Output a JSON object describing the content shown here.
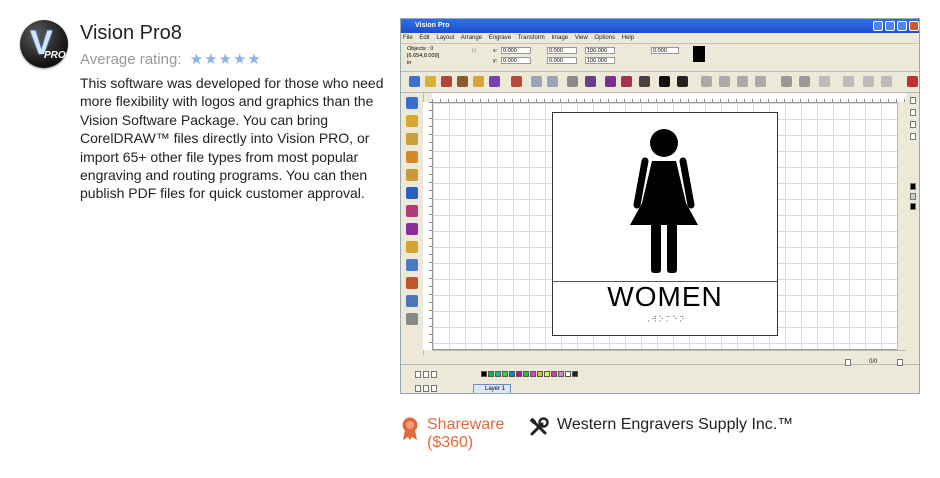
{
  "app": {
    "title": "Vision Pro8",
    "rating_label": "Average rating:",
    "stars": "★★★★★",
    "description": "This software was developed for those who need more flexibility with logos and graphics than the Vision Software Package. You can bring CorelDRAW™ files directly into Vision PRO, or import 65+ other file types from most popular engraving and routing programs. You can then publish PDF files for quick customer approval.",
    "license": "Shareware",
    "price": "($360)",
    "vendor": "Western Engravers Supply Inc.™"
  },
  "screenshot": {
    "window_title": "Vision Pro",
    "menu": [
      "File",
      "Edit",
      "Layout",
      "Arrange",
      "Engrave",
      "Transform",
      "Image",
      "View",
      "Options",
      "Help"
    ],
    "objects_label": "Objects : 0",
    "coords": "[6.654,8.009]",
    "units": "in",
    "x_value": "0.000",
    "y_value": "0.000",
    "w_value": "0.000",
    "h_value": "0.000",
    "w_pct": "100.000",
    "h_pct": "100.000",
    "rotation": "0.000",
    "sign_text": "WOMEN",
    "braille_text": "⠠⠺⠕⠍⠑⠝",
    "page_counter": "0/0",
    "layer_label": "Layer 1"
  },
  "colors": {
    "accent": "#e06a3c",
    "star": "#8cb3e6",
    "titlebar": "#2f6ee8"
  }
}
